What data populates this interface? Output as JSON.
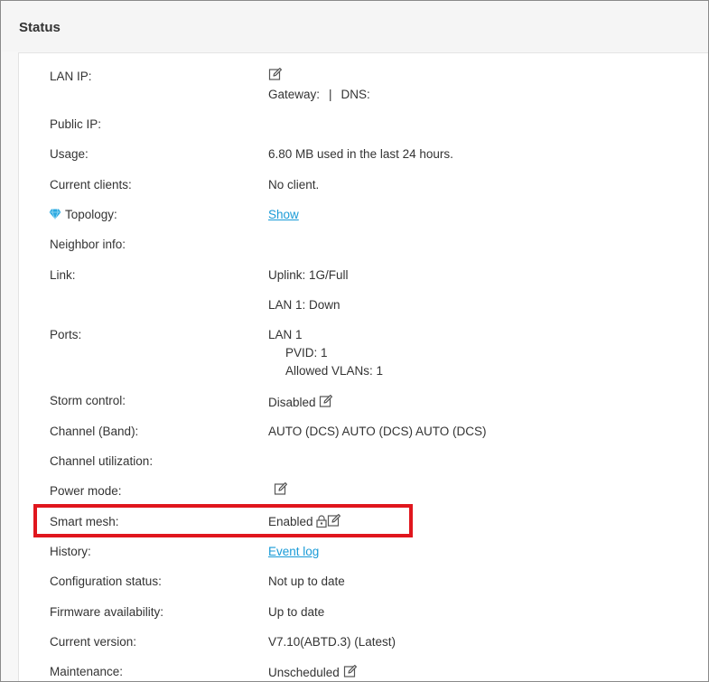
{
  "panel": {
    "title": "Status"
  },
  "rows": {
    "lan_ip": {
      "label": "LAN IP:",
      "gateway_label": "Gateway:",
      "separator": "|",
      "dns_label": "DNS:"
    },
    "public_ip": {
      "label": "Public IP:"
    },
    "usage": {
      "label": "Usage:",
      "value": "6.80 MB used in the last 24 hours."
    },
    "current_clients": {
      "label": "Current clients:",
      "value": "No client."
    },
    "topology": {
      "label": "Topology:",
      "link": "Show"
    },
    "neighbor_info": {
      "label": "Neighbor info:"
    },
    "link": {
      "label": "Link:",
      "uplink": "Uplink: 1G/Full",
      "lan1": "LAN 1: Down"
    },
    "ports": {
      "label": "Ports:",
      "port": "LAN 1",
      "pvid": "PVID: 1",
      "allowed_vlans": "Allowed VLANs:  1"
    },
    "storm_control": {
      "label": "Storm control:",
      "value": "Disabled"
    },
    "channel_band": {
      "label": "Channel (Band):",
      "value": "AUTO (DCS) AUTO (DCS) AUTO (DCS)"
    },
    "channel_utilization": {
      "label": "Channel utilization:"
    },
    "power_mode": {
      "label": "Power mode:"
    },
    "smart_mesh": {
      "label": "Smart mesh:",
      "value": "Enabled"
    },
    "history": {
      "label": "History:",
      "link": "Event log"
    },
    "configuration_status": {
      "label": "Configuration status:",
      "value": "Not up to date"
    },
    "firmware_availability": {
      "label": "Firmware availability:",
      "value": "Up to date"
    },
    "current_version": {
      "label": "Current version:",
      "value": "V7.10(ABTD.3) (Latest)"
    },
    "maintenance": {
      "label": "Maintenance:",
      "value": "Unscheduled"
    }
  },
  "colors": {
    "link": "#1a9bd7",
    "highlight": "#e0161d",
    "topology_gem": "#2aa8e0"
  },
  "icons": {
    "edit": "edit-icon",
    "lock": "lock-icon",
    "topology": "gem-icon"
  }
}
